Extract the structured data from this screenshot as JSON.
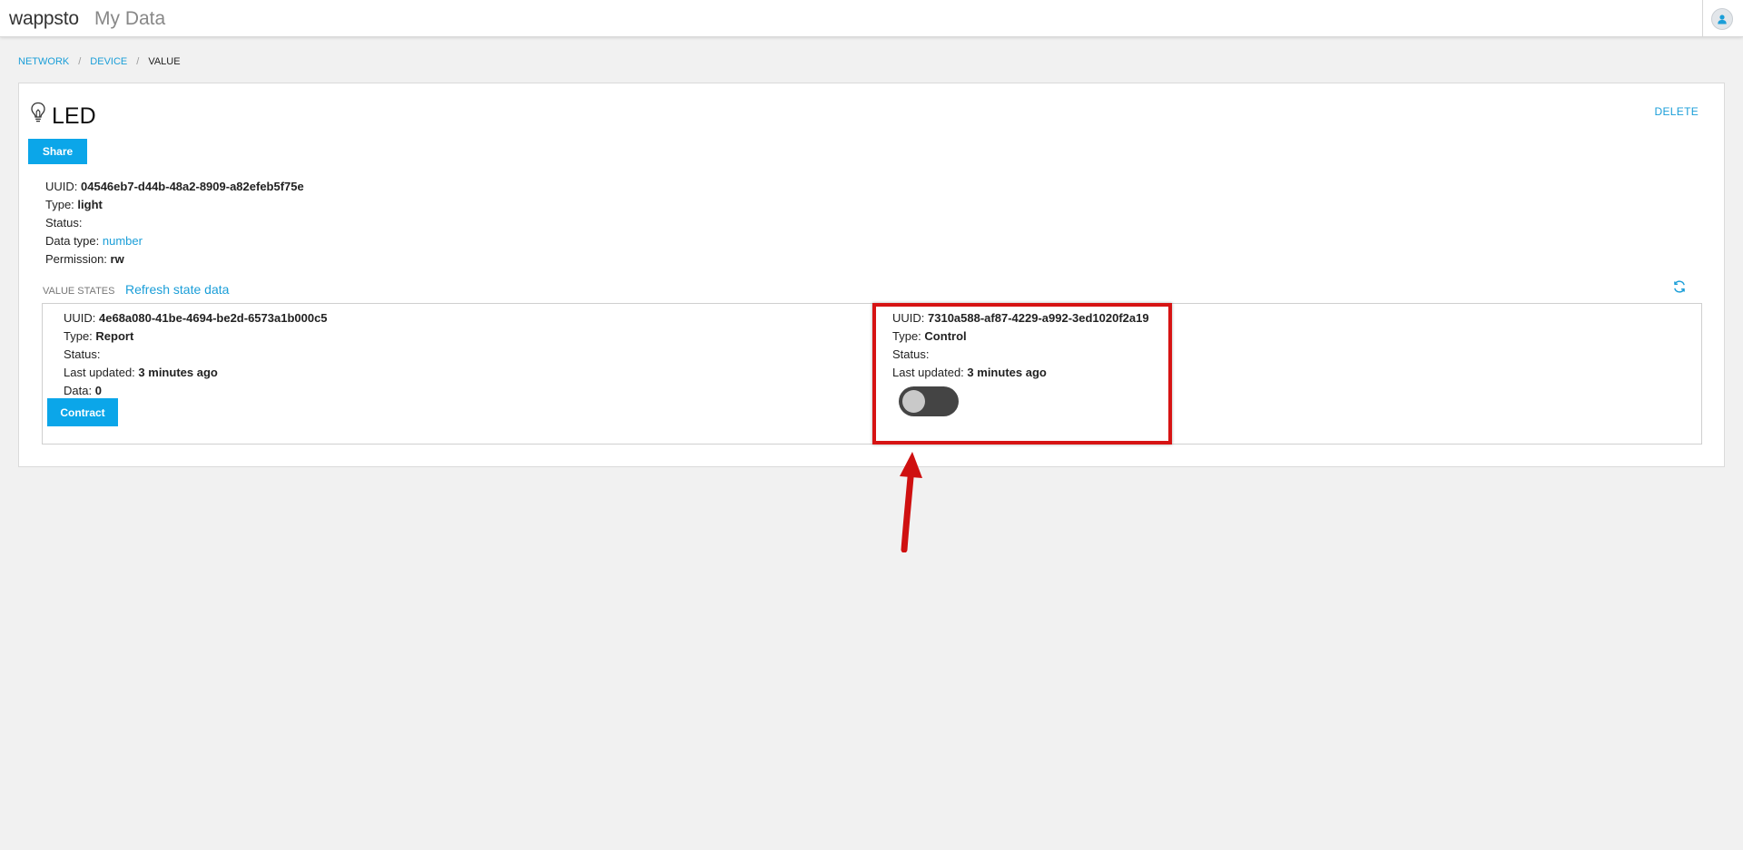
{
  "header": {
    "brand": "wappsto",
    "subtitle": "My Data"
  },
  "breadcrumb": {
    "items": [
      "NETWORK",
      "DEVICE"
    ],
    "current": "VALUE"
  },
  "value": {
    "icon": "lightbulb-icon",
    "title": "LED",
    "delete_label": "DELETE",
    "share_label": "Share",
    "properties": [
      {
        "label": "UUID:",
        "value": "04546eb7-d44b-48a2-8909-a82efeb5f75e"
      },
      {
        "label": "Type:",
        "value": "light"
      },
      {
        "label": "Status:",
        "value": ""
      },
      {
        "label": "Data type:",
        "value": "number"
      },
      {
        "label": "Permission:",
        "value": "rw"
      }
    ]
  },
  "value_states": {
    "label": "VALUE STATES",
    "refresh_label": "Refresh state data",
    "report": {
      "uuid_label": "UUID:",
      "uuid": "4e68a080-41be-4694-be2d-6573a1b000c5",
      "type_label": "Type:",
      "type": "Report",
      "status_label": "Status:",
      "status": "",
      "updated_label": "Last updated:",
      "updated": "3 minutes ago",
      "data_label": "Data:",
      "data": "0",
      "contract_label": "Contract"
    },
    "control": {
      "uuid_label": "UUID:",
      "uuid": "7310a588-af87-4229-a992-3ed1020f2a19",
      "type_label": "Type:",
      "type": "Control",
      "status_label": "Status:",
      "status": "",
      "updated_label": "Last updated:",
      "updated": "3 minutes ago",
      "toggle_on": false
    }
  },
  "colors": {
    "accent": "#0ba6e9",
    "link": "#1a9ed8",
    "annotation": "#d61313"
  }
}
